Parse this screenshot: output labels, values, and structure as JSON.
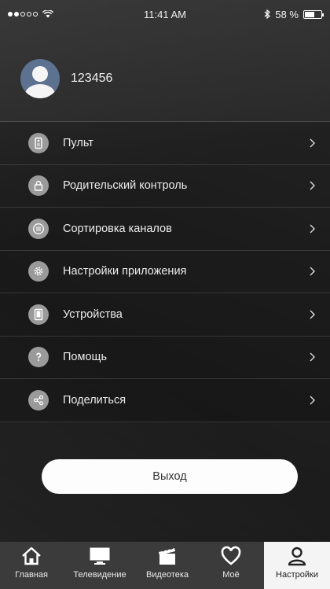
{
  "status_bar": {
    "time": "11:41 AM",
    "battery_text": "58 %",
    "battery_level": 0.58,
    "signal_filled": 2,
    "signal_total": 5
  },
  "profile": {
    "username": "123456"
  },
  "menu": {
    "items": [
      {
        "label": "Пульт",
        "icon": "remote-icon"
      },
      {
        "label": "Родительский контроль",
        "icon": "lock-icon"
      },
      {
        "label": "Сортировка каналов",
        "icon": "list-icon"
      },
      {
        "label": "Настройки приложения",
        "icon": "gear-icon"
      },
      {
        "label": "Устройства",
        "icon": "device-icon"
      },
      {
        "label": "Помощь",
        "icon": "help-icon"
      },
      {
        "label": "Поделиться",
        "icon": "share-icon"
      }
    ]
  },
  "logout_label": "Выход",
  "tabbar": {
    "tabs": [
      {
        "label": "Главная",
        "icon": "home-icon",
        "active": false
      },
      {
        "label": "Телевидение",
        "icon": "tv-icon",
        "active": false
      },
      {
        "label": "Видеотека",
        "icon": "clapperboard-icon",
        "active": false
      },
      {
        "label": "Моё",
        "icon": "heart-icon",
        "active": false
      },
      {
        "label": "Настройки",
        "icon": "user-icon",
        "active": true
      }
    ]
  },
  "colors": {
    "background": "#1c1c1c",
    "tabbar": "#3b3b3b",
    "active_tab": "#f4f4f4",
    "avatar": "#5d7191",
    "menu_icon_bg": "#9a9a9a"
  }
}
